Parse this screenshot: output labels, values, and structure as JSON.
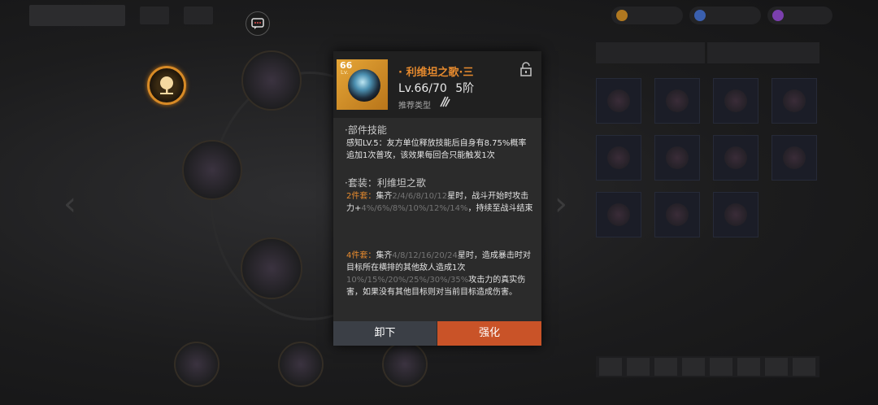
{
  "item": {
    "thumb_level_num": "66",
    "thumb_level_label": "Lv.",
    "title": "· 利维坦之歌·三",
    "level": "Lv.66/70",
    "rank": "5阶",
    "recommend_label": "推荐类型"
  },
  "skill": {
    "heading": "·部件技能",
    "text": "感知LV.5：友方单位释放技能后自身有8.75%概率追加1次普攻，该效果每回合只能触发1次"
  },
  "set": {
    "heading": "·套装：利维坦之歌",
    "two_piece": {
      "label": "2件套：",
      "lead": "集齐",
      "counts": "2/4/6/8/10/12",
      "mid": "星时，战斗开始时攻击力+",
      "values": "4%/6%/8%/10%/12%/14%",
      "tail": "，持续至战斗结束"
    },
    "four_piece": {
      "label": "4件套：",
      "lead": "集齐",
      "counts": "4/8/12/16/20/24",
      "mid": "星时，造成暴击时对目标所在横排的其他敌人造成1次",
      "values": "10%/15%/20%/25%/30%/35%",
      "tail": "攻击力的真实伤害，如果没有其他目标则对当前目标造成伤害。"
    }
  },
  "buttons": {
    "unequip": "卸下",
    "enhance": "强化"
  },
  "colors": {
    "accent_orange": "#e68a2e",
    "enhance_button": "#c95328",
    "unequip_button": "#3b3f46"
  },
  "icons": {
    "lock": "unlocked-padlock-icon",
    "recommend": "claw-slash-icon",
    "chat": "chat-bubble-icon",
    "tree": "tree-emblem-icon"
  }
}
